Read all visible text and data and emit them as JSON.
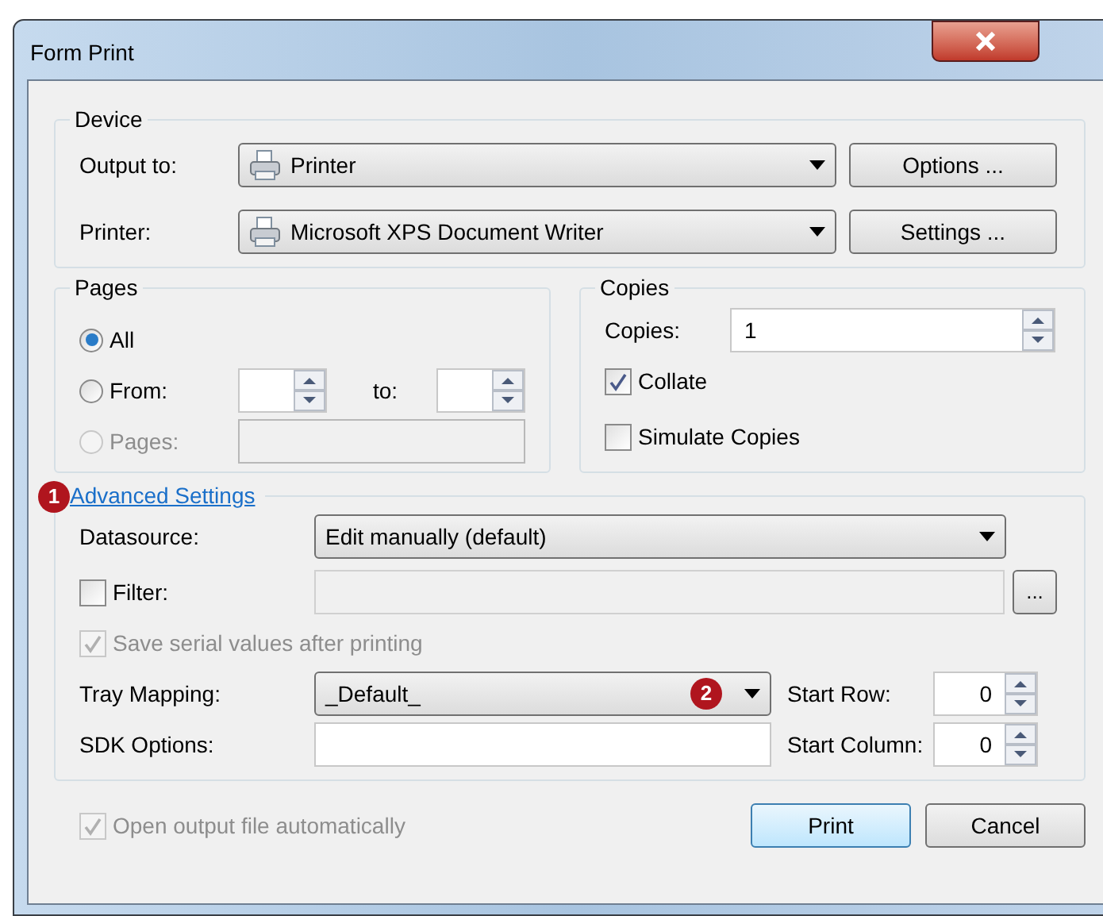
{
  "window": {
    "title": "Form Print"
  },
  "device": {
    "title": "Device",
    "rows": [
      {
        "label": "Output to:",
        "value": "Printer",
        "button": "Options ..."
      },
      {
        "label": "Printer:",
        "value": "Microsoft XPS Document Writer",
        "button": "Settings ..."
      }
    ]
  },
  "pages": {
    "title": "Pages",
    "to_label": "to:",
    "options": [
      {
        "label": "All",
        "selected": true,
        "disabled": false
      },
      {
        "label": "From:",
        "selected": false,
        "disabled": false
      },
      {
        "label": "Pages:",
        "selected": false,
        "disabled": true
      }
    ]
  },
  "copies": {
    "title": "Copies",
    "label": "Copies:",
    "value": "1",
    "checkboxes": [
      {
        "label": "Collate",
        "checked": true
      },
      {
        "label": "Simulate Copies",
        "checked": false
      }
    ]
  },
  "advanced": {
    "link": "Advanced Settings",
    "badge": "1",
    "datasource": {
      "label": "Datasource:",
      "value": "Edit manually (default)"
    },
    "filter": {
      "label": "Filter:",
      "checked": false,
      "browse": "..."
    },
    "save_serial": {
      "label": "Save serial values after printing",
      "checked": true,
      "disabled": true
    },
    "tray": {
      "label": "Tray Mapping:",
      "value": "_Default_",
      "badge": "2"
    },
    "sdk": {
      "label": "SDK Options:"
    },
    "start_row": {
      "label": "Start Row:",
      "value": "0"
    },
    "start_column": {
      "label": "Start Column:",
      "value": "0"
    }
  },
  "open_output": {
    "label": "Open output file automatically",
    "checked": true,
    "disabled": true
  },
  "buttons": [
    {
      "label": "Print",
      "default": true
    },
    {
      "label": "Cancel",
      "default": false
    }
  ]
}
